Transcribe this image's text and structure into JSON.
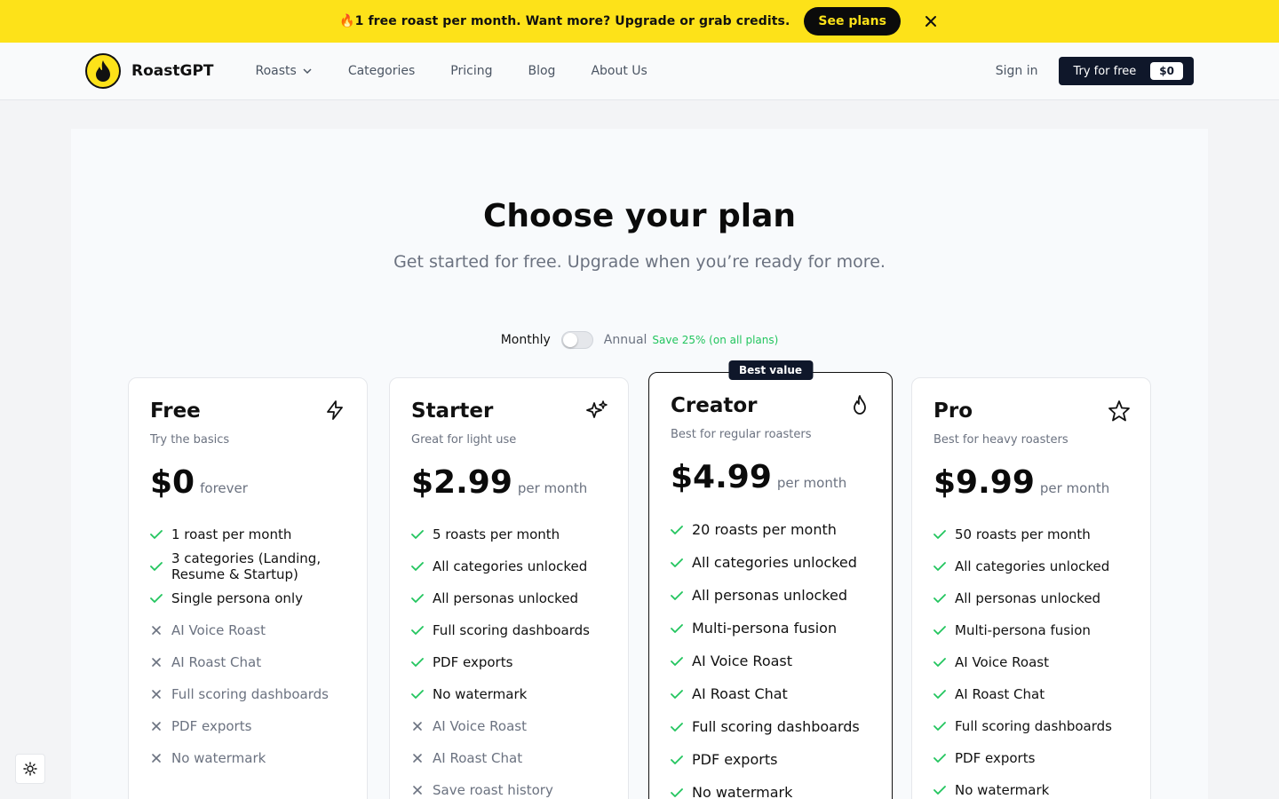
{
  "banner": {
    "emoji": "🔥",
    "text": "1 free roast per month. Want more? Upgrade or grab credits.",
    "cta": "See plans"
  },
  "nav": {
    "brand": "RoastGPT",
    "links": [
      "Roasts",
      "Categories",
      "Pricing",
      "Blog",
      "About Us"
    ],
    "sign_in": "Sign in",
    "try_label": "Try for free",
    "try_price": "$0"
  },
  "hero": {
    "title": "Choose your plan",
    "subtitle": "Get started for free. Upgrade when you’re ready for more."
  },
  "billing": {
    "monthly": "Monthly",
    "annual": "Annual",
    "save": "Save 25% (on all plans)",
    "annual_selected": false
  },
  "plans": [
    {
      "name": "Free",
      "tagline": "Try the basics",
      "price": "$0",
      "period": "forever",
      "icon": "lightning-icon",
      "features": [
        {
          "text": "1 roast per month",
          "included": true
        },
        {
          "text": "3 categories (Landing, Resume & Startup)",
          "included": true
        },
        {
          "text": "Single persona only",
          "included": true
        },
        {
          "text": "AI Voice Roast",
          "included": false
        },
        {
          "text": "AI Roast Chat",
          "included": false
        },
        {
          "text": "Full scoring dashboards",
          "included": false
        },
        {
          "text": "PDF exports",
          "included": false
        },
        {
          "text": "No watermark",
          "included": false
        }
      ]
    },
    {
      "name": "Starter",
      "tagline": "Great for light use",
      "price": "$2.99",
      "period": "per month",
      "icon": "sparkles-icon",
      "features": [
        {
          "text": "5 roasts per month",
          "included": true
        },
        {
          "text": "All categories unlocked",
          "included": true
        },
        {
          "text": "All personas unlocked",
          "included": true
        },
        {
          "text": "Full scoring dashboards",
          "included": true
        },
        {
          "text": "PDF exports",
          "included": true
        },
        {
          "text": "No watermark",
          "included": true
        },
        {
          "text": "AI Voice Roast",
          "included": false
        },
        {
          "text": "AI Roast Chat",
          "included": false
        },
        {
          "text": "Save roast history",
          "included": false
        }
      ]
    },
    {
      "name": "Creator",
      "tagline": "Best for regular roasters",
      "price": "$4.99",
      "period": "per month",
      "icon": "flame-icon",
      "badge": "Best value",
      "features": [
        {
          "text": "20 roasts per month",
          "included": true
        },
        {
          "text": "All categories unlocked",
          "included": true
        },
        {
          "text": "All personas unlocked",
          "included": true
        },
        {
          "text": "Multi-persona fusion",
          "included": true
        },
        {
          "text": "AI Voice Roast",
          "included": true
        },
        {
          "text": "AI Roast Chat",
          "included": true
        },
        {
          "text": "Full scoring dashboards",
          "included": true
        },
        {
          "text": "PDF exports",
          "included": true
        },
        {
          "text": "No watermark",
          "included": true
        }
      ]
    },
    {
      "name": "Pro",
      "tagline": "Best for heavy roasters",
      "price": "$9.99",
      "period": "per month",
      "icon": "star-icon",
      "features": [
        {
          "text": "50 roasts per month",
          "included": true
        },
        {
          "text": "All categories unlocked",
          "included": true
        },
        {
          "text": "All personas unlocked",
          "included": true
        },
        {
          "text": "Multi-persona fusion",
          "included": true
        },
        {
          "text": "AI Voice Roast",
          "included": true
        },
        {
          "text": "AI Roast Chat",
          "included": true
        },
        {
          "text": "Full scoring dashboards",
          "included": true
        },
        {
          "text": "PDF exports",
          "included": true
        },
        {
          "text": "No watermark",
          "included": true
        }
      ]
    }
  ],
  "colors": {
    "banner": "#fde219",
    "primary": "#0f172a",
    "check": "#22c55e",
    "muted": "#6b7280"
  }
}
